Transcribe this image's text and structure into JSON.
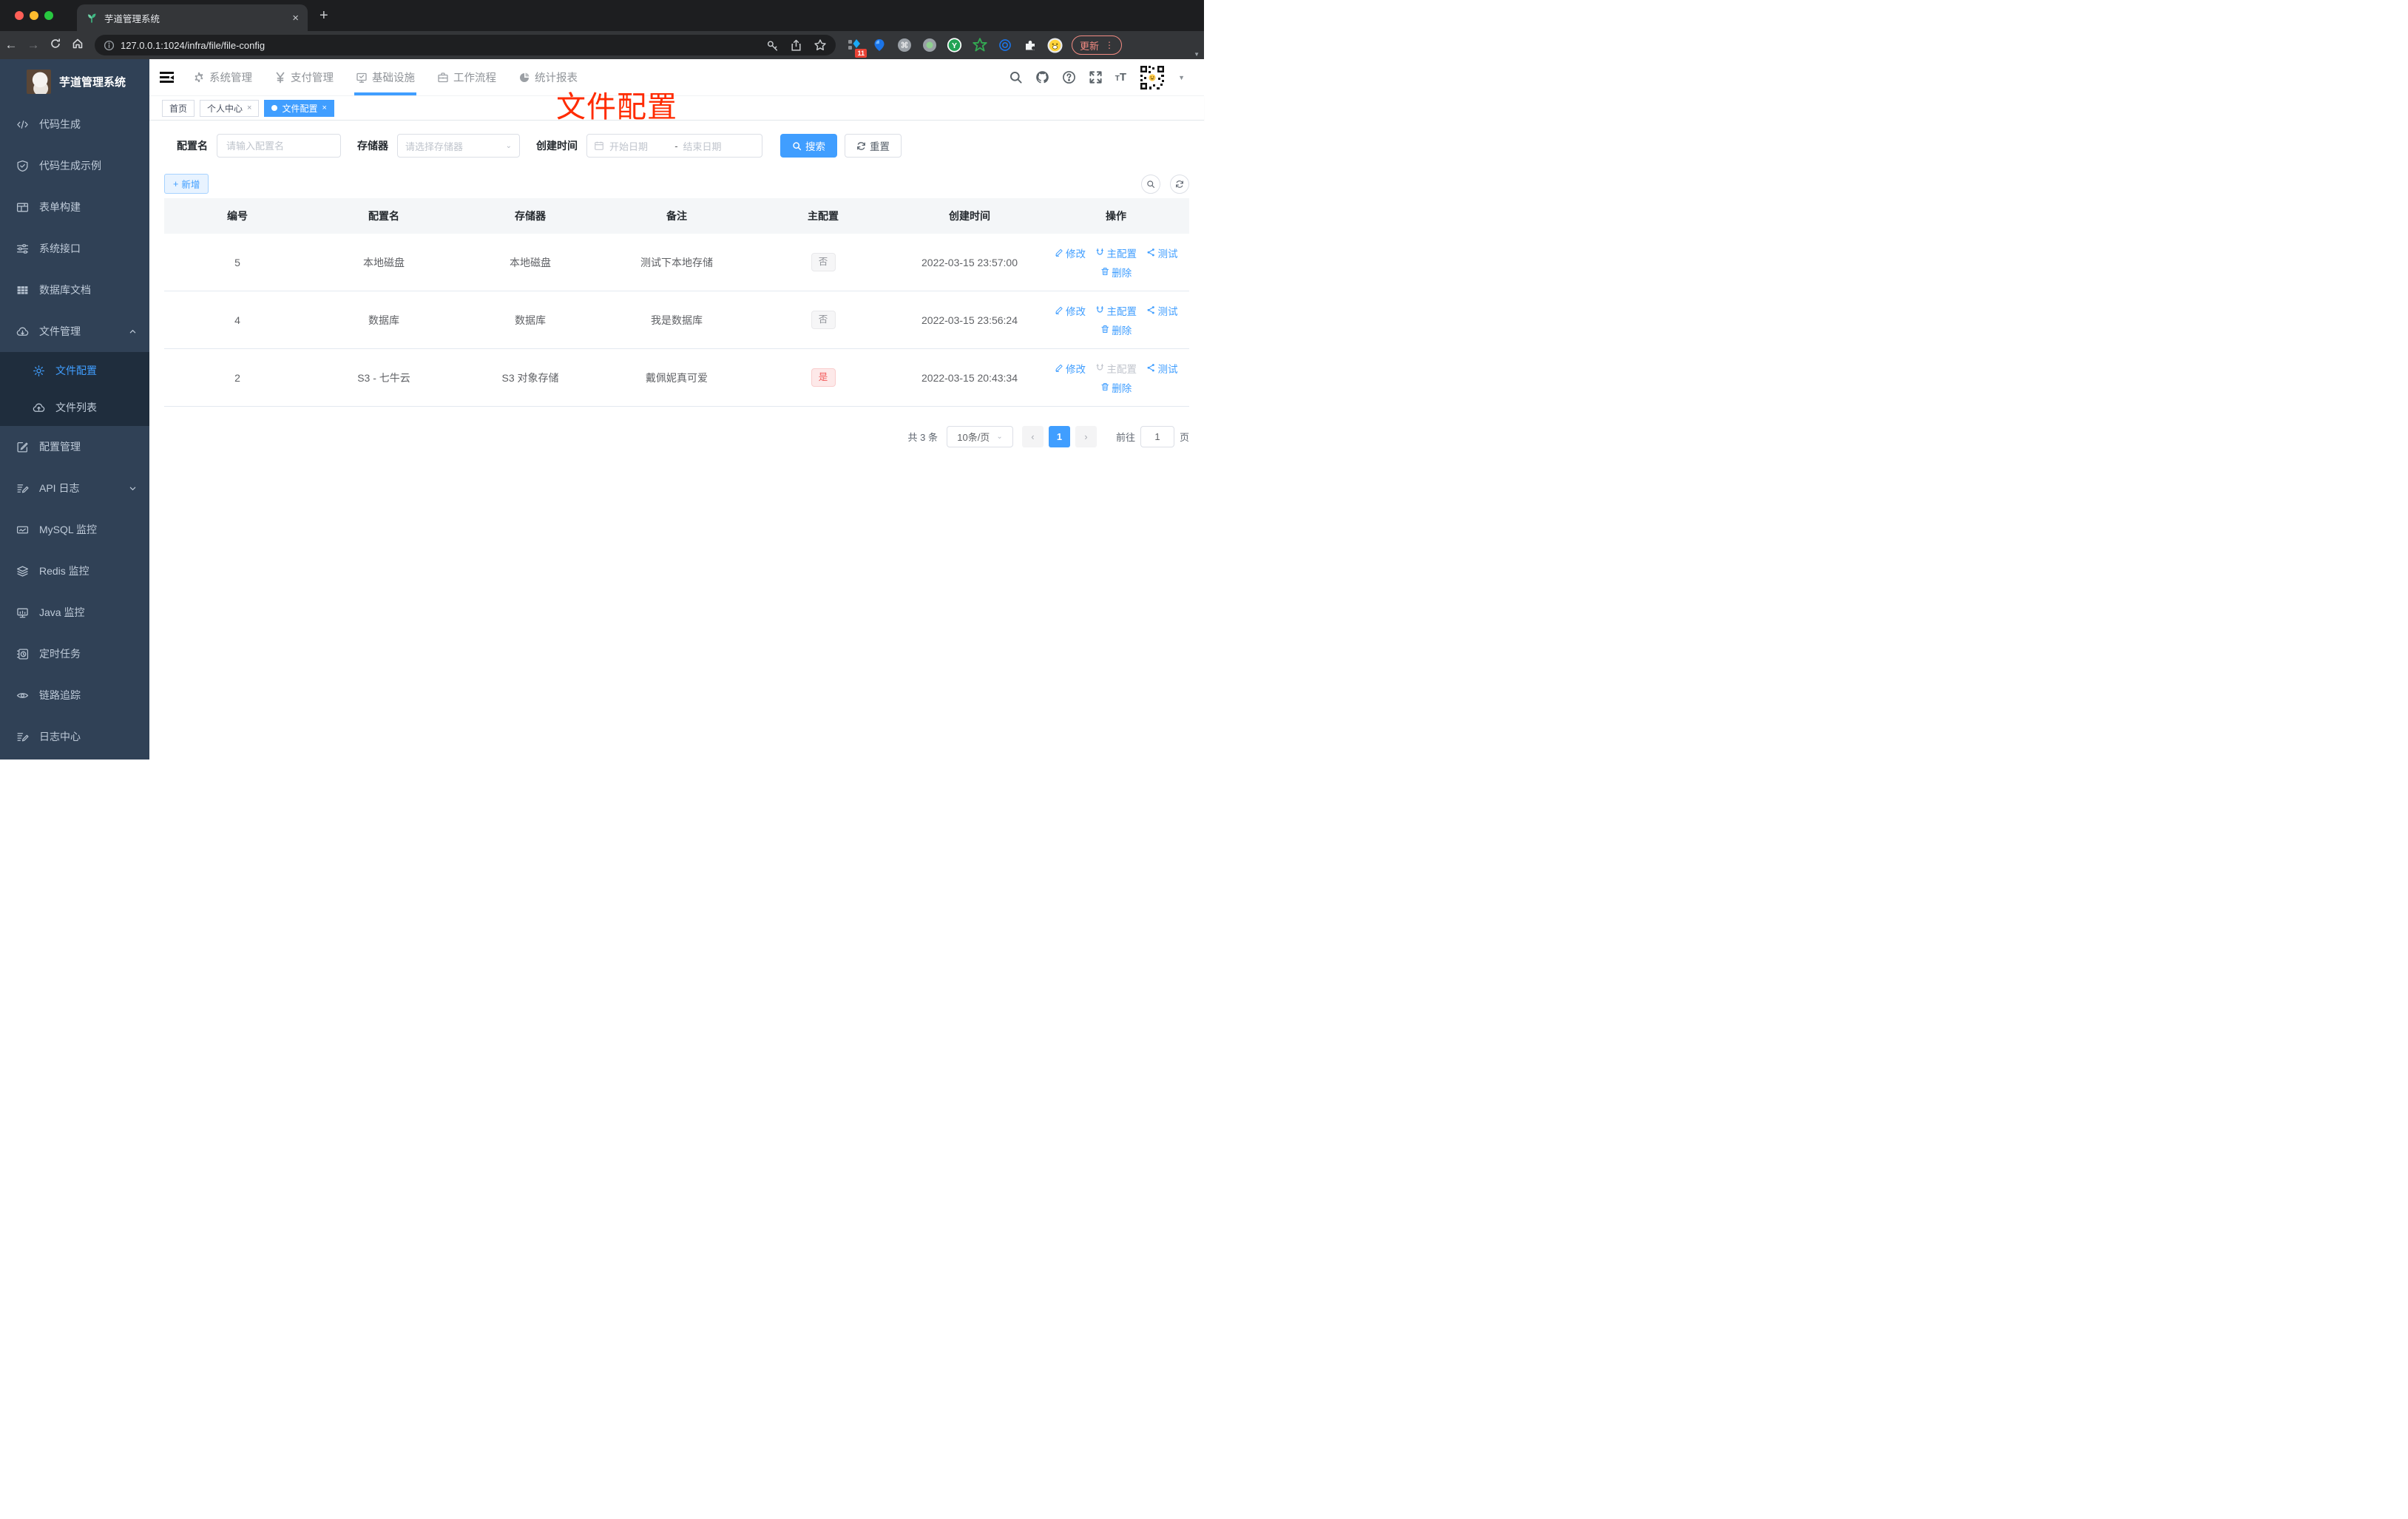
{
  "browser": {
    "tab_title": "芋道管理系统",
    "tab_close": "×",
    "new_tab": "+",
    "url": "127.0.0.1:1024/infra/file/file-config",
    "ext_badge": "11",
    "update_label": "更新",
    "menu_dots": "⋮"
  },
  "sidebar": {
    "title": "芋道管理系统",
    "items": [
      {
        "label": "代码生成",
        "icon": "code-icon"
      },
      {
        "label": "代码生成示例",
        "icon": "shield-icon"
      },
      {
        "label": "表单构建",
        "icon": "form-icon"
      },
      {
        "label": "系统接口",
        "icon": "sliders-icon"
      },
      {
        "label": "数据库文档",
        "icon": "grid-icon"
      },
      {
        "label": "文件管理",
        "icon": "cloud-down-icon",
        "expanded": true
      },
      {
        "label": "文件配置",
        "icon": "gear-icon",
        "active": true
      },
      {
        "label": "文件列表",
        "icon": "cloud-up-icon"
      },
      {
        "label": "配置管理",
        "icon": "edit-square-icon"
      },
      {
        "label": "API 日志",
        "icon": "doc-edit-icon",
        "collapsed": true
      },
      {
        "label": "MySQL 监控",
        "icon": "chart-icon"
      },
      {
        "label": "Redis 监控",
        "icon": "layers-icon"
      },
      {
        "label": "Java 监控",
        "icon": "monitor-icon"
      },
      {
        "label": "定时任务",
        "icon": "timer-icon"
      },
      {
        "label": "链路追踪",
        "icon": "eye-icon"
      },
      {
        "label": "日志中心",
        "icon": "doc-edit-icon"
      }
    ]
  },
  "topnav": {
    "items": [
      {
        "label": "系统管理",
        "icon": "gear-icon"
      },
      {
        "label": "支付管理",
        "icon": "yen-icon"
      },
      {
        "label": "基础设施",
        "icon": "monitor-check-icon",
        "active": true
      },
      {
        "label": "工作流程",
        "icon": "briefcase-icon"
      },
      {
        "label": "统计报表",
        "icon": "dashboard-icon"
      }
    ]
  },
  "tags": [
    {
      "label": "首页"
    },
    {
      "label": "个人中心",
      "closable": true
    },
    {
      "label": "文件配置",
      "closable": true,
      "active": true
    }
  ],
  "annotation": "文件配置",
  "filters": {
    "name_label": "配置名",
    "name_placeholder": "请输入配置名",
    "storage_label": "存储器",
    "storage_placeholder": "请选择存储器",
    "time_label": "创建时间",
    "start_placeholder": "开始日期",
    "range_separator": "-",
    "end_placeholder": "结束日期",
    "search_label": "搜索",
    "reset_label": "重置"
  },
  "toolbar": {
    "add_label": "新增"
  },
  "table": {
    "headers": [
      "编号",
      "配置名",
      "存储器",
      "备注",
      "主配置",
      "创建时间",
      "操作"
    ],
    "actions": {
      "edit": "修改",
      "master": "主配置",
      "test": "测试",
      "del": "删除"
    },
    "rows": [
      {
        "id": "5",
        "name": "本地磁盘",
        "storage": "本地磁盘",
        "remark": "测试下本地存储",
        "master": "否",
        "master_type": "info",
        "created": "2022-03-15 23:57:00",
        "master_disabled": false
      },
      {
        "id": "4",
        "name": "数据库",
        "storage": "数据库",
        "remark": "我是数据库",
        "master": "否",
        "master_type": "info",
        "created": "2022-03-15 23:56:24",
        "master_disabled": false
      },
      {
        "id": "2",
        "name": "S3 - 七牛云",
        "storage": "S3 对象存储",
        "remark": "戴佩妮真可爱",
        "master": "是",
        "master_type": "danger",
        "created": "2022-03-15 20:43:34",
        "master_disabled": true
      }
    ]
  },
  "pagination": {
    "total": "共 3 条",
    "page_size": "10条/页",
    "prev": "‹",
    "current": "1",
    "next": "›",
    "goto_label": "前往",
    "goto_value": "1",
    "page_suffix": "页"
  }
}
